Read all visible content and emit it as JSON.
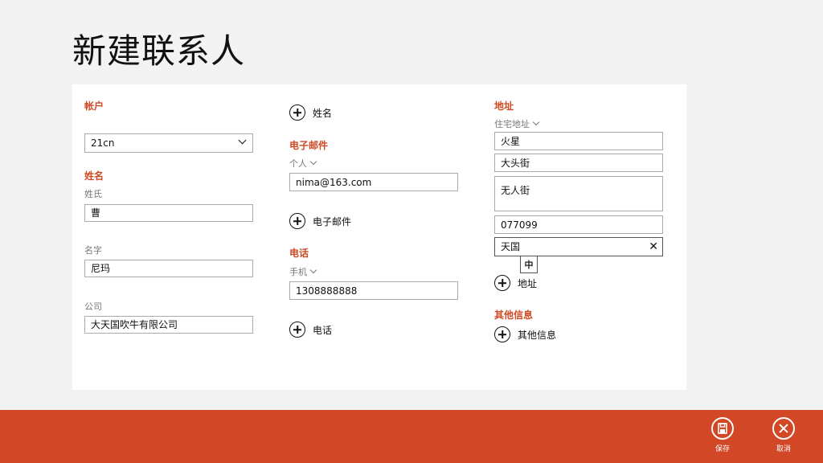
{
  "page": {
    "title": "新建联系人"
  },
  "account": {
    "section_label": "帐户",
    "selected": "21cn"
  },
  "name": {
    "section_label": "姓名",
    "surname_label": "姓氏",
    "surname_value": "曹",
    "given_label": "名字",
    "given_value": "尼玛",
    "company_label": "公司",
    "company_value": "大天国吹牛有限公司",
    "add_label": "姓名"
  },
  "email": {
    "section_label": "电子邮件",
    "type_label": "个人",
    "value": "nima@163.com",
    "add_label": "电子邮件"
  },
  "phone": {
    "section_label": "电话",
    "type_label": "手机",
    "value": "1308888888",
    "add_label": "电话"
  },
  "address": {
    "section_label": "地址",
    "type_label": "住宅地址",
    "line1": "火星",
    "line2": "大头街",
    "line3": "无人街",
    "postal": "077099",
    "country": "天国",
    "add_label": "地址"
  },
  "ime": {
    "indicator": "中"
  },
  "other": {
    "section_label": "其他信息",
    "add_label": "其他信息"
  },
  "appbar": {
    "save_label": "保存",
    "cancel_label": "取消",
    "accent": "#d24726"
  },
  "icons": [
    "plus-circle-icon",
    "chevron-down-icon",
    "clear-icon",
    "save-icon",
    "cancel-icon"
  ]
}
